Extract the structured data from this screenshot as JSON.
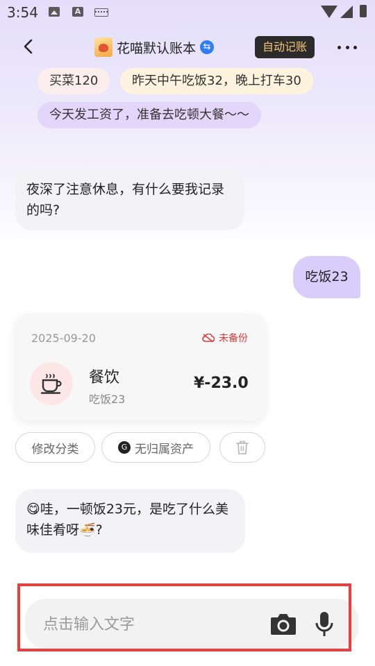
{
  "status_bar": {
    "time": "3:54",
    "icons": [
      "gallery-icon",
      "a-keyboard-icon",
      "keyboard-icon",
      "wifi-icon",
      "signal-icon",
      "battery-icon"
    ]
  },
  "header": {
    "back_icon": "chevron-left-icon",
    "ledger_title": "花喵默认账本",
    "switch_icon": "sync-icon",
    "auto_record_label": "自动记账",
    "more_icon": "more-horizontal-icon"
  },
  "suggestions": [
    "买菜120",
    "昨天中午吃饭32，晚上打车30",
    "今天发工资了，准备去吃顿大餐～～"
  ],
  "messages": {
    "assistant_1": "夜深了注意休息，有什么要我记录的吗?",
    "user_1": "吃饭23",
    "assistant_2_emoji_start": "😋",
    "assistant_2": "哇，一顿饭23元，是吃了什么美味佳肴呀",
    "assistant_2_emoji_end": "🍜?"
  },
  "record_card": {
    "date": "2025-09-20",
    "backup_status": "未备份",
    "category_icon": "coffee-cup-icon",
    "category": "餐饮",
    "note": "吃饭23",
    "amount": "¥-23.0"
  },
  "actions": {
    "edit_category": "修改分类",
    "asset": "无归属资产",
    "asset_icon_glyph": "G",
    "delete_icon": "trash-icon"
  },
  "input": {
    "placeholder": "点击输入文字",
    "camera_icon": "camera-icon",
    "mic_icon": "microphone-icon"
  },
  "colors": {
    "accent_purple": "#d8cdfb",
    "header_button_bg": "#2b2b2b",
    "header_button_text": "#f3c874",
    "unbacked_red": "#e53935",
    "highlight_frame": "#ef3b3b"
  }
}
